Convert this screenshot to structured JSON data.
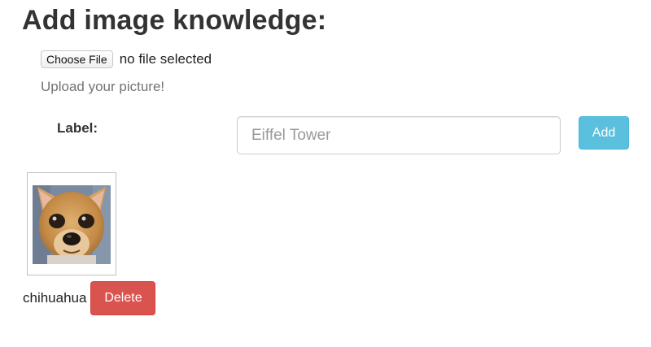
{
  "page": {
    "title": "Add image knowledge:"
  },
  "upload": {
    "choose_file_label": "Choose File",
    "file_status": "no file selected",
    "help_text": "Upload your picture!"
  },
  "label_form": {
    "label": "Label:",
    "input_value": "",
    "input_placeholder": "Eiffel Tower",
    "add_label": "Add"
  },
  "knowledge_items": [
    {
      "image_icon": "chihuahua-photo",
      "caption": "chihuahua",
      "delete_label": "Delete"
    }
  ],
  "colors": {
    "add_button": "#5bc0de",
    "delete_button": "#d9534f",
    "help_text": "#737373"
  }
}
